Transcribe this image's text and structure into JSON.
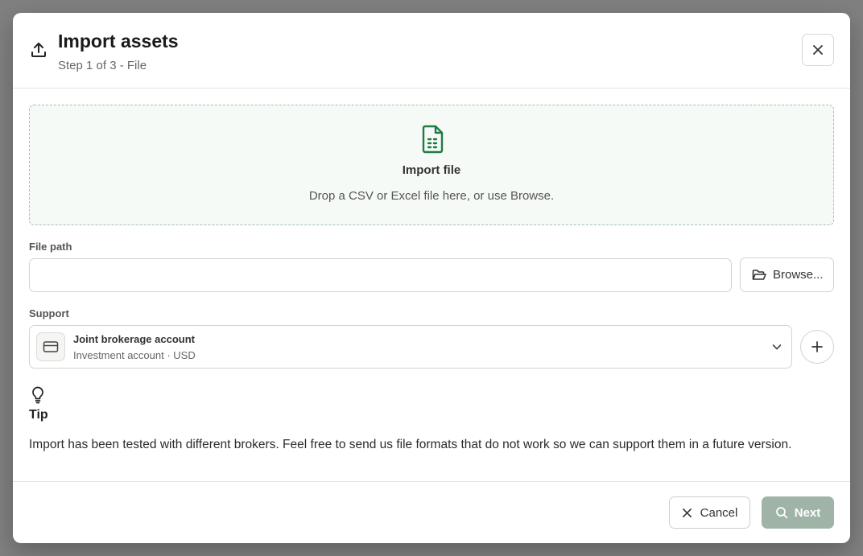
{
  "dialog": {
    "title": "Import assets",
    "subtitle": "Step 1 of 3 - File",
    "header_icon": "upload-icon",
    "close_icon": "close-icon"
  },
  "dropzone": {
    "icon": "spreadsheet-file-icon",
    "title": "Import file",
    "hint": "Drop a CSV or Excel file here, or use Browse."
  },
  "file_path": {
    "label": "File path",
    "value": "",
    "placeholder": "",
    "browse_label": "Browse...",
    "browse_icon": "folder-open-icon"
  },
  "support": {
    "label": "Support",
    "selected_name": "Joint brokerage account",
    "selected_meta": "Investment account · USD",
    "account_icon": "credit-card-icon",
    "dropdown_icon": "chevron-down-icon",
    "add_icon": "plus-icon"
  },
  "tip": {
    "icon": "lightbulb-icon",
    "title": "Tip",
    "text": "Import has been tested with different brokers. Feel free to send us file formats that do not work so we can support them in a future version."
  },
  "footer": {
    "cancel_label": "Cancel",
    "next_label": "Next"
  },
  "colors": {
    "accent": "#1f7a45",
    "overlay": "#808080",
    "next_disabled": "#9fb4a7",
    "dropzone_bg": "#f6faf6"
  }
}
